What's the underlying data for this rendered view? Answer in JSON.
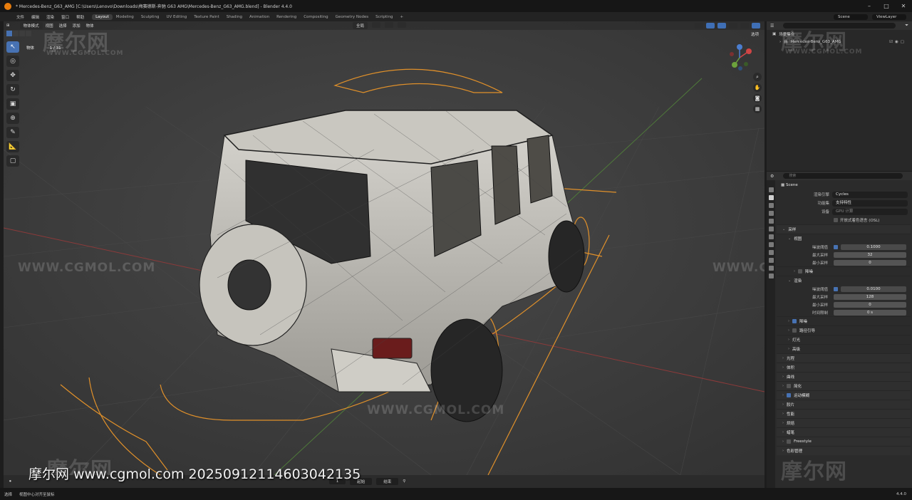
{
  "window": {
    "title": "* Mercedes-Benz_G63_AMG [C:\\Users\\Lenovo\\Downloads\\梅赛德斯-奔驰 G63 AMG\\Mercedes-Benz_G63_AMG.blend] - Blender 4.4.0",
    "min": "–",
    "max": "□",
    "close": "✕"
  },
  "menu": [
    "文件",
    "编辑",
    "渲染",
    "窗口",
    "帮助"
  ],
  "workspaces": [
    "Layout",
    "Modeling",
    "Sculpting",
    "UV Editing",
    "Texture Paint",
    "Shading",
    "Animation",
    "Rendering",
    "Compositing",
    "Geometry Nodes",
    "Scripting",
    "+"
  ],
  "topbar": {
    "scene": "Scene",
    "view_layer": "ViewLayer"
  },
  "viewport": {
    "mode": "物体模式",
    "menus": [
      "视图",
      "选择",
      "添加",
      "物体"
    ],
    "transform": "全局",
    "options": "选项",
    "object_label": "物体",
    "object_count": "1 / 31"
  },
  "watermarks": {
    "logo": "摩尔网",
    "url": "WWW.CGMOL.COM"
  },
  "caption": "摩尔网 www.cgmol.com 20250912114603042135",
  "timeline": {
    "frame_label": "帧",
    "current": "1",
    "start_label": "起始",
    "end_label": "结束"
  },
  "status": {
    "select": "选择",
    "center_view": "视图中心对齐至鼠标",
    "version": "4.4.0"
  },
  "outliner": {
    "search_placeholder": "",
    "root": "场景集合",
    "child": "Mercedes-Benz_G63_AMG"
  },
  "properties": {
    "search_placeholder": "搜索",
    "scene": "Scene",
    "render_engine_label": "渲染引擎",
    "render_engine": "Cycles",
    "feature_set_label": "功能集",
    "feature_set": "支持特性",
    "device_label": "设备",
    "device": "GPU 计算",
    "osl": "开放式着色语言 (OSL)",
    "sampling": "采样",
    "viewport": "视图",
    "vp_noise_label": "噪波阈值",
    "vp_noise": "0.1000",
    "vp_max_label": "最大采样",
    "vp_max": "32",
    "vp_min_label": "最小采样",
    "vp_min": "0",
    "denoise": "降噪",
    "render": "渲染",
    "r_noise_label": "噪波阈值",
    "r_noise": "0.0100",
    "r_max_label": "最大采样",
    "r_max": "128",
    "r_min_label": "最小采样",
    "r_min": "0",
    "time_limit_label": "时间限制",
    "time_limit": "0 s",
    "denoise2": "降噪",
    "path_guiding": "路径引导",
    "lights": "灯光",
    "advanced": "高级",
    "light_paths": "光程",
    "volumes": "体积",
    "curves": "曲线",
    "simplify": "简化",
    "motion_blur": "运动模糊",
    "film": "胶片",
    "performance": "性能",
    "bake": "烘焙",
    "grease_pencil": "蜡笔",
    "freestyle": "Freestyle",
    "color_management": "色彩管理"
  }
}
